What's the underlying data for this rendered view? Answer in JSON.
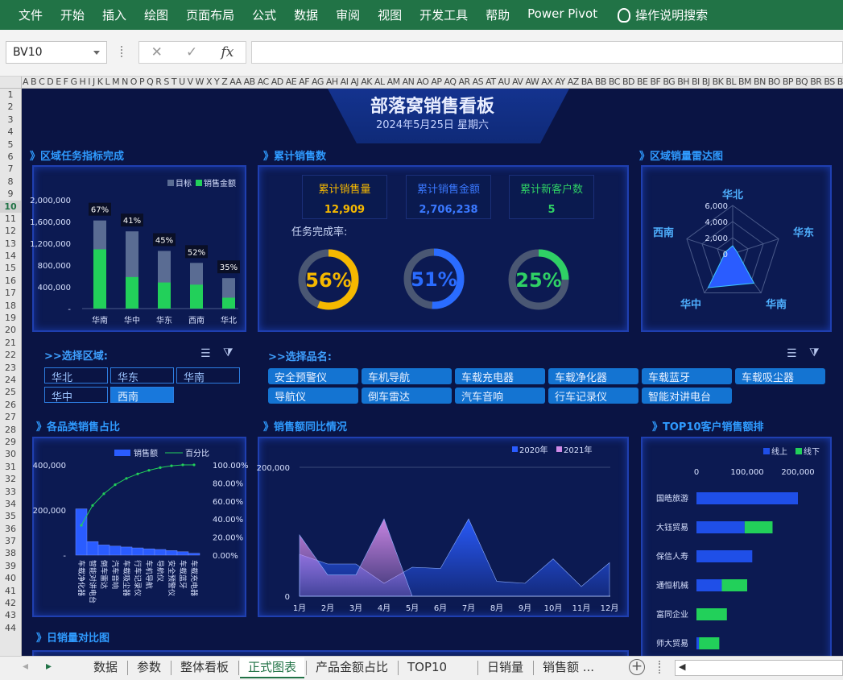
{
  "ribbon": {
    "tabs": [
      "文件",
      "开始",
      "插入",
      "绘图",
      "页面布局",
      "公式",
      "数据",
      "审阅",
      "视图",
      "开发工具",
      "帮助",
      "Power Pivot"
    ],
    "search": "操作说明搜索"
  },
  "formula_bar": {
    "name_box": "BV10",
    "cancel": "✕",
    "enter": "✓",
    "fx": "fx",
    "formula": ""
  },
  "columns": "A B C D E F G H I J K L M N O P Q R S T U V W X Y Z AA AB AC AD AE AF AG AH AI AJ AK AL AM AN AO AP AQ AR AS AT AU AV AW AX AY AZ BA BB BC BD BE BF BG BH BI BJ BK BL BM BN BO BP BQ BR BS BT BU",
  "rows": [
    "1",
    "2",
    "3",
    "4",
    "5",
    "6",
    "7",
    "8",
    "9",
    "10",
    "11",
    "12",
    "13",
    "14",
    "15",
    "16",
    "17",
    "18",
    "19",
    "20",
    "21",
    "22",
    "23",
    "24",
    "25",
    "26",
    "27",
    "28",
    "29",
    "30",
    "31",
    "32",
    "33",
    "34",
    "35",
    "36",
    "37",
    "38",
    "39",
    "40",
    "41",
    "42",
    "43",
    "44"
  ],
  "active_row": "10",
  "dashboard": {
    "title": "部落窝销售看板",
    "date": "2024年5月25日 星期六",
    "sections": {
      "region_task": "》区域任务指标完成",
      "cumulative": "》累计销售数",
      "radar": "》区域销量雷达图",
      "category_share": "》各品类销售占比",
      "yoy": "》销售额同比情况",
      "top10": "》TOP10客户销售额排",
      "daily": "》日销量对比图"
    },
    "kpis": [
      {
        "label": "累计销售量",
        "value": "12,909",
        "color": "#f5b800"
      },
      {
        "label": "累计销售金额",
        "value": "2,706,238",
        "color": "#3a78ff"
      },
      {
        "label": "累计新客户数",
        "value": "5",
        "color": "#2fd065"
      }
    ],
    "completion_label": "任务完成率:",
    "gauges": [
      {
        "pct": 0.56,
        "text": "56%",
        "color": "#f5b800"
      },
      {
        "pct": 0.51,
        "text": "51%",
        "color": "#2a6cff"
      },
      {
        "pct": 0.25,
        "text": "25%",
        "color": "#2fd065"
      }
    ],
    "filters": {
      "region_label": ">>选择区域:",
      "regions": [
        {
          "name": "华北",
          "selected": false
        },
        {
          "name": "华东",
          "selected": false
        },
        {
          "name": "华南",
          "selected": false
        },
        {
          "name": "华中",
          "selected": false
        },
        {
          "name": "西南",
          "selected": true
        }
      ],
      "product_label": ">>选择品名:",
      "products": [
        "安全预警仪",
        "车机导航",
        "车载充电器",
        "车载净化器",
        "车载蓝牙",
        "车载吸尘器",
        "导航仪",
        "倒车雷达",
        "汽车音响",
        "行车记录仪",
        "智能对讲电台"
      ]
    },
    "sheets": [
      "数据",
      "参数",
      "整体看板",
      "正式图表",
      "产品金额占比",
      "TOP10",
      "日销量",
      "销售额 ..."
    ],
    "active_sheet": "正式图表"
  },
  "chart_data": [
    {
      "type": "bar",
      "title": "",
      "categories": [
        "华南",
        "华中",
        "华东",
        "西南",
        "华北"
      ],
      "series": [
        {
          "name": "目标",
          "values": [
            1620000,
            1420000,
            1060000,
            840000,
            560000
          ],
          "color": "#5a6c93"
        },
        {
          "name": "销售金额",
          "values": [
            1090000,
            580000,
            480000,
            440000,
            200000
          ],
          "color": "#22d05a"
        }
      ],
      "data_labels": [
        "67%",
        "41%",
        "45%",
        "52%",
        "35%"
      ],
      "ylim": [
        0,
        2000000
      ],
      "yticks": [
        "2,000,000",
        "1,600,000",
        "1,200,000",
        "800,000",
        "400,000",
        "-"
      ],
      "legend": "top-right"
    },
    {
      "type": "radar",
      "categories": [
        "华北",
        "华东",
        "华南",
        "华中",
        "西南"
      ],
      "values": [
        1000,
        600,
        4500,
        5200,
        900
      ],
      "rlim": [
        0,
        6000
      ],
      "ticks": [
        "6,000",
        "4,000",
        "2,000",
        "0"
      ]
    },
    {
      "type": "bar",
      "title": "",
      "categories": [
        "车载净化器",
        "智能对讲电台",
        "倒车雷达",
        "汽车音响",
        "车载吸尘器",
        "行车记录仪",
        "车机导航",
        "导航仪",
        "安全预警仪",
        "车载蓝牙",
        "车载充电器"
      ],
      "series": [
        {
          "name": "销售额",
          "values": [
            205000,
            60000,
            45000,
            40000,
            36000,
            32000,
            28000,
            25000,
            20000,
            15000,
            8000
          ],
          "color": "#2a5cff"
        },
        {
          "name": "百分比",
          "values": [
            0.33,
            0.55,
            0.68,
            0.78,
            0.85,
            0.9,
            0.94,
            0.97,
            0.99,
            1.0,
            1.0
          ],
          "color": "#22d05a"
        }
      ],
      "ylim": [
        0,
        400000
      ],
      "yticks": [
        "400,000",
        "200,000",
        "-"
      ],
      "y2ticks": [
        "100.00%",
        "80.00%",
        "60.00%",
        "40.00%",
        "20.00%",
        "0.00%"
      ],
      "legend": "top"
    },
    {
      "type": "area",
      "title": "",
      "categories": [
        "1月",
        "2月",
        "3月",
        "4月",
        "5月",
        "6月",
        "7月",
        "8月",
        "9月",
        "10月",
        "11月",
        "12月"
      ],
      "series": [
        {
          "name": "2020年",
          "values": [
            65000,
            50000,
            50000,
            20000,
            45000,
            43000,
            120000,
            23000,
            20000,
            58000,
            15000,
            52000
          ],
          "color": "#2a5cff"
        },
        {
          "name": "2021年",
          "values": [
            95000,
            33000,
            33000,
            120000,
            0
          ],
          "color": "#d08ae8"
        }
      ],
      "ylim": [
        0,
        200000
      ],
      "yticks": [
        "200,000",
        "0"
      ],
      "legend": "top-right"
    },
    {
      "type": "bar",
      "orientation": "horizontal",
      "title": "",
      "categories": [
        "国皓旅游",
        "大钰贸易",
        "保信人寿",
        "通恒机械",
        "富同企业",
        "师大贸易"
      ],
      "series": [
        {
          "name": "线上",
          "values": [
            200000,
            95000,
            110000,
            50000,
            0,
            5000
          ],
          "color": "#1f4fe8"
        },
        {
          "name": "线下",
          "values": [
            0,
            55000,
            0,
            50000,
            60000,
            40000
          ],
          "color": "#22d05a"
        }
      ],
      "xlim": [
        0,
        200000
      ],
      "xticks": [
        "0",
        "100,000",
        "200,000"
      ],
      "legend": "top-right"
    }
  ]
}
